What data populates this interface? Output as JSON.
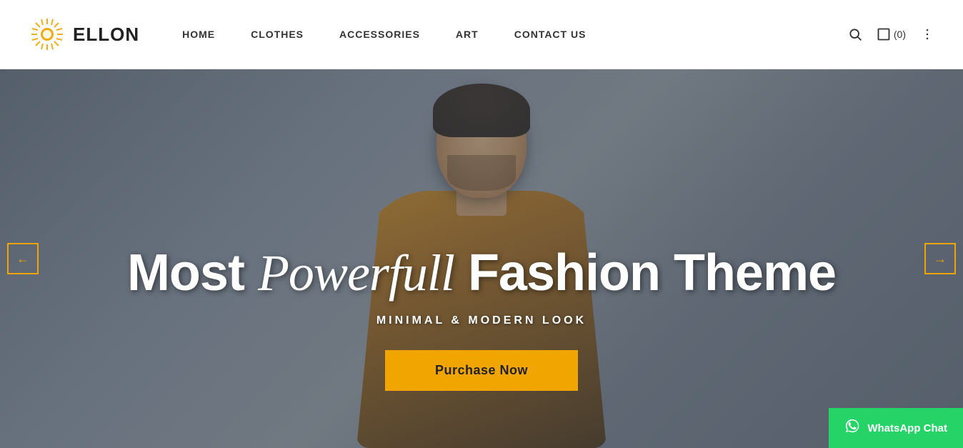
{
  "header": {
    "logo_text": "ELLON",
    "nav_items": [
      {
        "label": "HOME",
        "id": "home"
      },
      {
        "label": "CLOTHES",
        "id": "clothes"
      },
      {
        "label": "ACCESSORIES",
        "id": "accessories"
      },
      {
        "label": "ART",
        "id": "art"
      },
      {
        "label": "CONTACT US",
        "id": "contact"
      }
    ],
    "cart_label": "(0)",
    "search_aria": "Search",
    "menu_aria": "Menu"
  },
  "hero": {
    "title_part1": "Most ",
    "title_italic": "Powerfull",
    "title_part2": " Fashion Theme",
    "subtitle": "MINIMAL & MODERN LOOK",
    "cta_label": "Purchase Now",
    "arrow_left": "←",
    "arrow_right": "→"
  },
  "whatsapp": {
    "label": "WhatsApp Chat"
  },
  "colors": {
    "accent": "#f0a500",
    "whatsapp_green": "#25d366",
    "text_dark": "#222222",
    "text_nav": "#333333"
  }
}
